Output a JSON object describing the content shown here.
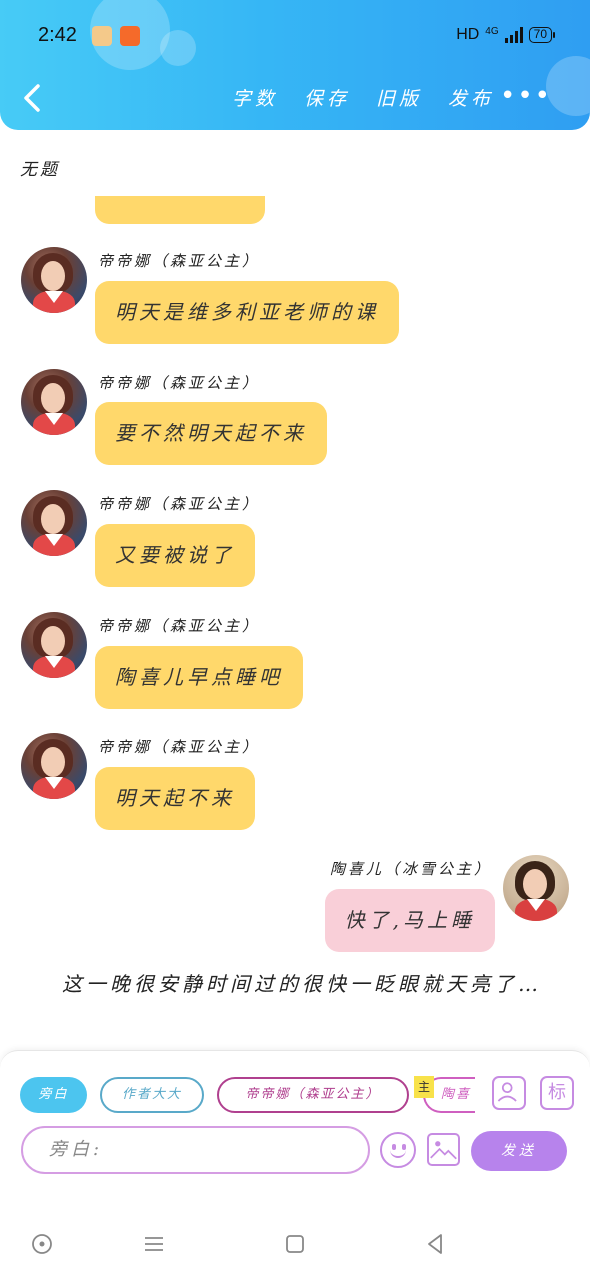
{
  "status_bar": {
    "time": "2:42",
    "app_icon_a": "",
    "app_icon_b": "",
    "hd": "HD",
    "network": "4G",
    "battery": "70"
  },
  "header": {
    "actions": [
      {
        "label": "字数"
      },
      {
        "label": "保存"
      },
      {
        "label": "旧版"
      },
      {
        "label": "发布"
      }
    ],
    "more": "•••"
  },
  "doc_title": "无题",
  "messages": [
    {
      "sender": "帝帝娜（森亚公主）",
      "text": "明天是维多利亚老师的课"
    },
    {
      "sender": "帝帝娜（森亚公主）",
      "text": "要不然明天起不来"
    },
    {
      "sender": "帝帝娜（森亚公主）",
      "text": "又要被说了"
    },
    {
      "sender": "帝帝娜（森亚公主）",
      "text": "陶喜儿早点睡吧"
    },
    {
      "sender": "帝帝娜（森亚公主）",
      "text": "明天起不来"
    },
    {
      "sender": "陶喜儿（冰雪公主）",
      "text": "快了,马上睡"
    }
  ],
  "narration": "这一晚很安静时间过的很快一眨眼就天亮了…",
  "input_panel": {
    "roles": [
      {
        "label": "旁白"
      },
      {
        "label": "作者大大"
      },
      {
        "label": "帝帝娜（森亚公主）"
      },
      {
        "label": "陶喜"
      }
    ],
    "main_tag": "主",
    "tag_button": "标",
    "input_placeholder": "旁白:",
    "send_label": "发送"
  },
  "colors": {
    "header_start": "#47cbf6",
    "header_end": "#2f9ef2",
    "bubble_left": "#ffd86b",
    "bubble_right": "#f9cfd8",
    "accent_purple": "#b783ec"
  }
}
